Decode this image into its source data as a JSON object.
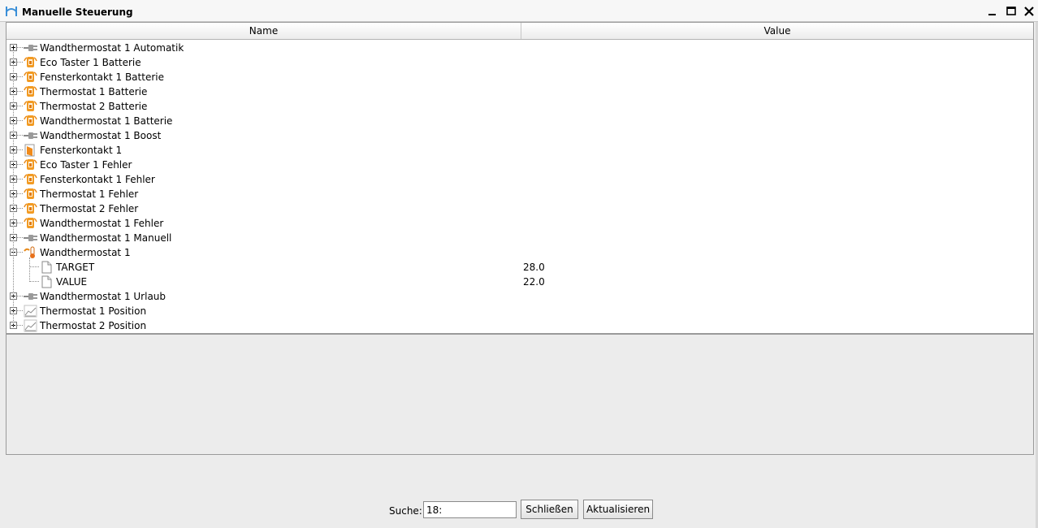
{
  "window": {
    "title": "Manuelle Steuerung"
  },
  "table": {
    "headers": {
      "name": "Name",
      "value": "Value"
    },
    "rows": [
      {
        "label": "Wandthermostat 1 Automatik",
        "icon": "plug-icon"
      },
      {
        "label": "Eco Taster 1 Batterie",
        "icon": "battery-icon"
      },
      {
        "label": "Fensterkontakt 1 Batterie",
        "icon": "battery-icon"
      },
      {
        "label": "Thermostat 1 Batterie",
        "icon": "battery-icon"
      },
      {
        "label": "Thermostat 2 Batterie",
        "icon": "battery-icon"
      },
      {
        "label": "Wandthermostat 1 Batterie",
        "icon": "battery-icon"
      },
      {
        "label": "Wandthermostat 1 Boost",
        "icon": "plug-icon"
      },
      {
        "label": "Fensterkontakt 1",
        "icon": "window-contact-icon"
      },
      {
        "label": "Eco Taster 1 Fehler",
        "icon": "battery-icon"
      },
      {
        "label": "Fensterkontakt 1 Fehler",
        "icon": "battery-icon"
      },
      {
        "label": "Thermostat 1 Fehler",
        "icon": "battery-icon"
      },
      {
        "label": "Thermostat 2 Fehler",
        "icon": "battery-icon"
      },
      {
        "label": "Wandthermostat 1 Fehler",
        "icon": "battery-icon"
      },
      {
        "label": "Wandthermostat 1 Manuell",
        "icon": "plug-icon"
      },
      {
        "label": "Wandthermostat 1",
        "icon": "thermometer-icon",
        "expanded": true
      },
      {
        "label": "TARGET",
        "value": "28.0",
        "icon": "document-icon",
        "child": true
      },
      {
        "label": "VALUE",
        "value": "22.0",
        "icon": "document-icon",
        "child": true
      },
      {
        "label": "Wandthermostat 1 Urlaub",
        "icon": "plug-icon"
      },
      {
        "label": "Thermostat 1 Position",
        "icon": "chart-icon"
      },
      {
        "label": "Thermostat 2 Position",
        "icon": "chart-icon"
      }
    ]
  },
  "footer": {
    "search_label": "Suche:",
    "search_value": "18:",
    "close_label": "Schließen",
    "refresh_label": "Aktualisieren"
  }
}
